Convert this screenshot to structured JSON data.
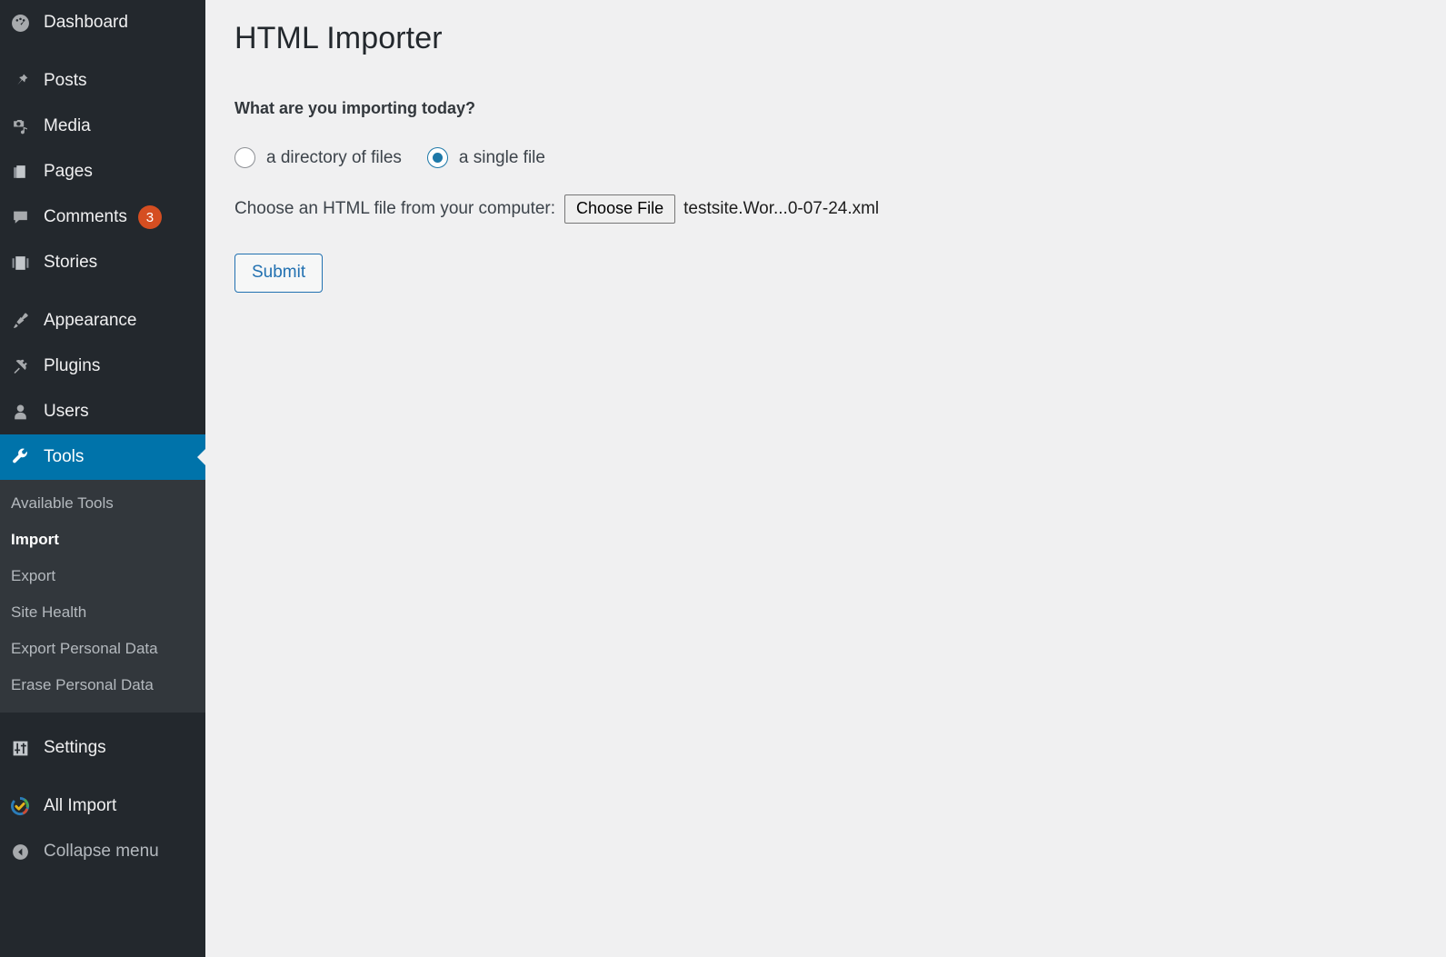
{
  "sidebar": {
    "items": [
      {
        "label": "Dashboard",
        "icon": "dashboard-icon",
        "current": false,
        "badge": null
      },
      {
        "label": "Posts",
        "icon": "pin-icon",
        "current": false,
        "badge": null
      },
      {
        "label": "Media",
        "icon": "media-icon",
        "current": false,
        "badge": null
      },
      {
        "label": "Pages",
        "icon": "pages-icon",
        "current": false,
        "badge": null
      },
      {
        "label": "Comments",
        "icon": "comments-icon",
        "current": false,
        "badge": "3"
      },
      {
        "label": "Stories",
        "icon": "stories-icon",
        "current": false,
        "badge": null
      },
      {
        "label": "Appearance",
        "icon": "brush-icon",
        "current": false,
        "badge": null
      },
      {
        "label": "Plugins",
        "icon": "plugin-icon",
        "current": false,
        "badge": null
      },
      {
        "label": "Users",
        "icon": "user-icon",
        "current": false,
        "badge": null
      },
      {
        "label": "Tools",
        "icon": "wrench-icon",
        "current": true,
        "badge": null
      },
      {
        "label": "Settings",
        "icon": "settings-icon",
        "current": false,
        "badge": null
      },
      {
        "label": "All Import",
        "icon": "all-import-icon",
        "current": false,
        "badge": null
      }
    ],
    "submenu": [
      {
        "label": "Available Tools",
        "current": false
      },
      {
        "label": "Import",
        "current": true
      },
      {
        "label": "Export",
        "current": false
      },
      {
        "label": "Site Health",
        "current": false
      },
      {
        "label": "Export Personal Data",
        "current": false
      },
      {
        "label": "Erase Personal Data",
        "current": false
      }
    ],
    "collapse": {
      "label": "Collapse menu",
      "icon": "collapse-arrow-icon"
    },
    "colors": {
      "background": "#23282d",
      "submenu_background": "#32373c",
      "current_item": "#0073aa",
      "badge": "#d54e21"
    }
  },
  "main": {
    "title": "HTML Importer",
    "prompt": "What are you importing today?",
    "radio_options": [
      {
        "label": "a directory of files",
        "selected": false
      },
      {
        "label": "a single file",
        "selected": true
      }
    ],
    "file_picker": {
      "label": "Choose an HTML file from your computer:",
      "button_label": "Choose File",
      "file_name": "testsite.Wor...0-07-24.xml"
    },
    "submit_label": "Submit",
    "colors": {
      "background": "#f0f0f1",
      "accent": "#2271b1",
      "radio_selected": "#1d78a8"
    }
  }
}
